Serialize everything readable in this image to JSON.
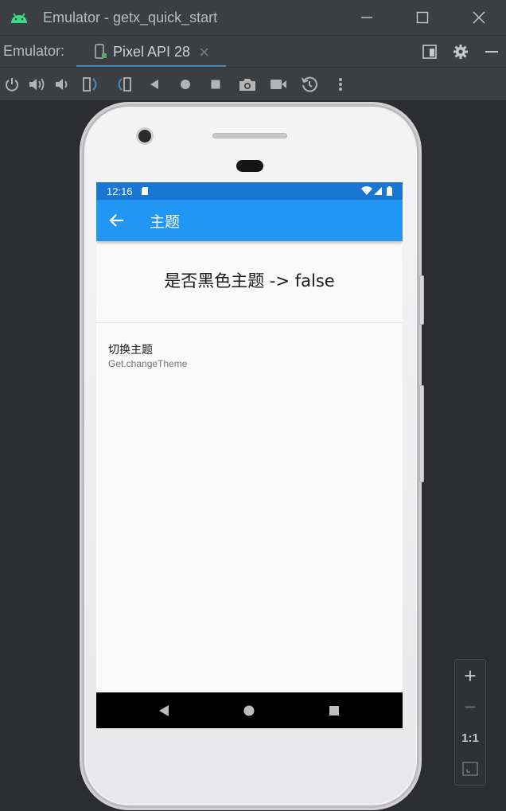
{
  "window": {
    "title": "Emulator - getx_quick_start",
    "icons": [
      "android-icon",
      "minimize-icon",
      "maximize-icon",
      "close-icon"
    ]
  },
  "tabbar": {
    "label": "Emulator:",
    "tab_label": "Pixel API 28",
    "tab_close": "×",
    "icons": [
      "device-icon",
      "layout-icon",
      "settings-icon",
      "hide-icon"
    ]
  },
  "toolbar": {
    "tools": [
      "power",
      "volume-up",
      "volume-down",
      "rotate-left",
      "rotate-right",
      "back",
      "home",
      "overview",
      "screenshot",
      "record",
      "snapshot-restore",
      "more"
    ]
  },
  "device": {
    "status_time": "12:16",
    "appbar_title": "主题",
    "heading": "是否黑色主题 -> false",
    "list_item_title": "切换主题",
    "list_item_subtitle": "Get.changeTheme"
  },
  "zoom": {
    "zoom_in": "+",
    "zoom_out": "−",
    "actual_size": "1:1"
  },
  "colors": {
    "ide_bg": "#2b2d30",
    "ide_bar": "#3c3f41",
    "status_bar": "#1976d2",
    "app_bar": "#2196f3",
    "accent": "#4a88c7"
  }
}
